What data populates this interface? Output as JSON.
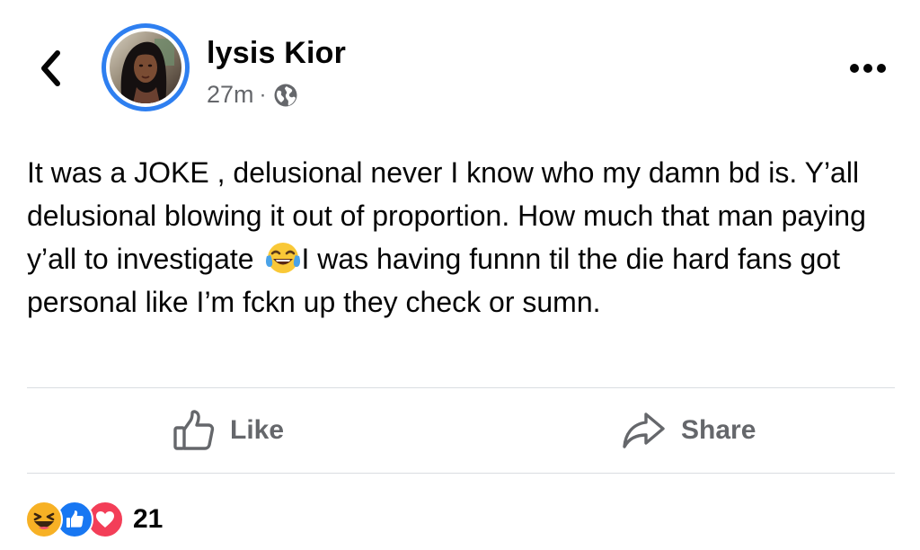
{
  "post": {
    "author_name": "lysis Kior",
    "timestamp": "27m",
    "meta_separator": "·",
    "audience_icon": "globe-icon",
    "body_parts": {
      "before_emoji": "It was a JOKE , delusional never I know who my damn bd is. Y’all delusional blowing it out of proportion. How much that man paying y’all to investigate ",
      "emoji": "face-with-tears-of-joy",
      "after_emoji": "I was having funnn til the die hard fans got personal like I’m fckn up they check or sumn."
    }
  },
  "actions": {
    "like_label": "Like",
    "share_label": "Share"
  },
  "reactions": {
    "types": [
      "haha",
      "like",
      "love"
    ],
    "count": "21"
  },
  "icons": {
    "back": "chevron-left-icon",
    "more": "more-options-icon",
    "like": "thumbs-up-icon",
    "share": "share-arrow-icon"
  },
  "colors": {
    "avatar_ring": "#2e7ff0",
    "secondary_text": "#65676b",
    "like_blue": "#1877f2",
    "love_red": "#f33e58",
    "haha_yellow": "#f7b125"
  }
}
